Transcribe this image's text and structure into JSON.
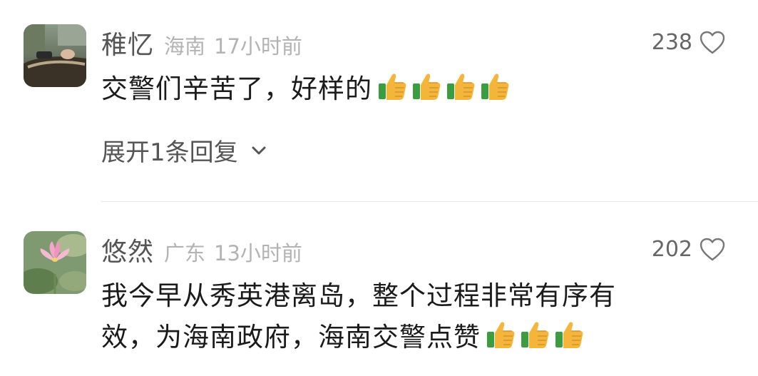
{
  "comments": [
    {
      "username": "稚忆",
      "location": "海南",
      "time": "17小时前",
      "likes": "238",
      "text_lines": [
        "交警们辛苦了，好样的"
      ],
      "emoji": [
        "thumbs-up",
        "thumbs-up",
        "thumbs-up",
        "thumbs-up"
      ],
      "expand_label": "展开1条回复"
    },
    {
      "username": "悠然",
      "location": "广东",
      "time": "13小时前",
      "likes": "202",
      "text_lines": [
        "我今早从秀英港离岛，整个过程非常有序有",
        "效，为海南政府，海南交警点赞"
      ],
      "emoji": [
        "thumbs-up",
        "thumbs-up",
        "thumbs-up"
      ]
    }
  ],
  "colors": {
    "username": "#555555",
    "meta": "#b3b3b3",
    "body_text": "#1b1b1b",
    "divider": "#e6e6e6"
  }
}
